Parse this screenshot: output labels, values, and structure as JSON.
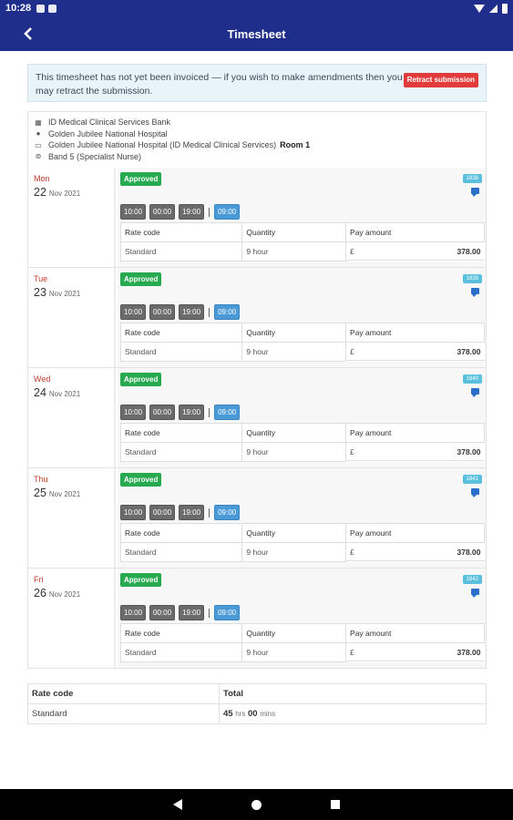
{
  "status_bar": {
    "time": "10:28"
  },
  "app_bar": {
    "title": "Timesheet"
  },
  "notice": {
    "text": "This timesheet has not yet been invoiced — if you wish to make amendments then you may retract the submission.",
    "button_label": "Retract submission"
  },
  "details": {
    "agency": "ID Medical Clinical Services Bank",
    "hospital": "Golden Jubilee National Hospital",
    "location": "Golden Jubilee National Hospital (ID Medical Clinical Services)",
    "room": "Room 1",
    "role": "Band 5 (Specialist Nurse)"
  },
  "table_headers": {
    "rate_code": "Rate code",
    "quantity": "Quantity",
    "pay_amount": "Pay amount"
  },
  "days": [
    {
      "dayname": "Mon",
      "daynum": "22",
      "month": "Nov 2021",
      "status": "Approved",
      "id": "1838",
      "times": [
        "10:00",
        "00:00",
        "19:00"
      ],
      "hours_badge": "09:00",
      "rate_code": "Standard",
      "quantity": "9 hour",
      "currency": "£",
      "amount": "378.00"
    },
    {
      "dayname": "Tue",
      "daynum": "23",
      "month": "Nov 2021",
      "status": "Approved",
      "id": "1839",
      "times": [
        "10:00",
        "00:00",
        "19:00"
      ],
      "hours_badge": "09:00",
      "rate_code": "Standard",
      "quantity": "9 hour",
      "currency": "£",
      "amount": "378.00"
    },
    {
      "dayname": "Wed",
      "daynum": "24",
      "month": "Nov 2021",
      "status": "Approved",
      "id": "1840",
      "times": [
        "10:00",
        "00:00",
        "19:00"
      ],
      "hours_badge": "09:00",
      "rate_code": "Standard",
      "quantity": "9 hour",
      "currency": "£",
      "amount": "378.00"
    },
    {
      "dayname": "Thu",
      "daynum": "25",
      "month": "Nov 2021",
      "status": "Approved",
      "id": "1841",
      "times": [
        "10:00",
        "00:00",
        "19:00"
      ],
      "hours_badge": "09:00",
      "rate_code": "Standard",
      "quantity": "9 hour",
      "currency": "£",
      "amount": "378.00"
    },
    {
      "dayname": "Fri",
      "daynum": "26",
      "month": "Nov 2021",
      "status": "Approved",
      "id": "1842",
      "times": [
        "10:00",
        "00:00",
        "19:00"
      ],
      "hours_badge": "09:00",
      "rate_code": "Standard",
      "quantity": "9 hour",
      "currency": "£",
      "amount": "378.00"
    }
  ],
  "summary": {
    "header_rate_code": "Rate code",
    "header_total": "Total",
    "rate_code": "Standard",
    "hours": "45",
    "hours_unit": "hrs",
    "mins": "00",
    "mins_unit": "mins"
  },
  "colors": {
    "primary": "#1f2e8a",
    "approved": "#27a94f",
    "retract": "#e23b3b",
    "hours_badge": "#4a9ad8",
    "day_name": "#c0392b"
  }
}
